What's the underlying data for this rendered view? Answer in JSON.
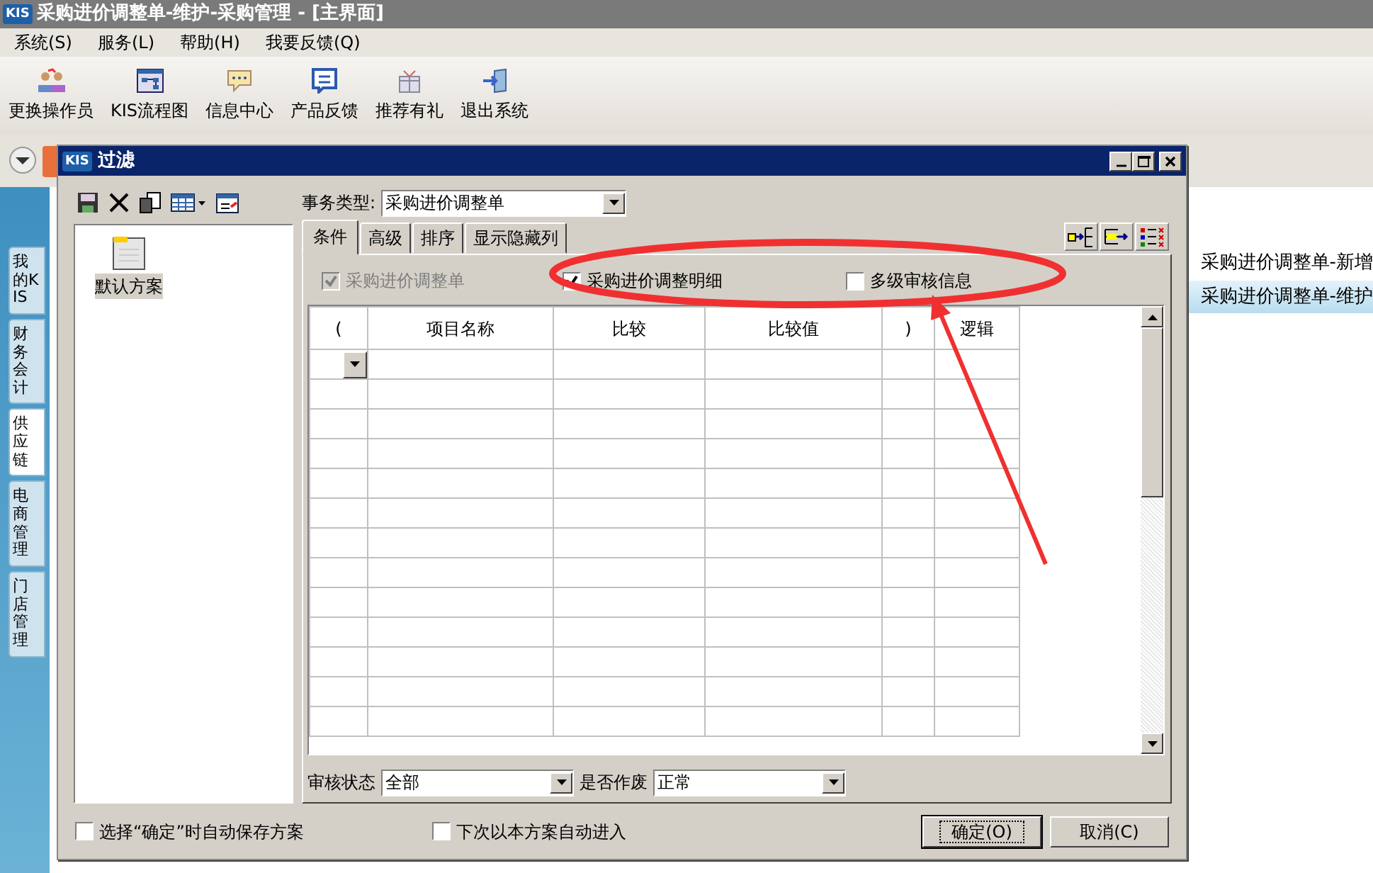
{
  "window": {
    "logo": "KIS",
    "title": "采购进价调整单-维护-采购管理 - [主界面]"
  },
  "menu": [
    {
      "label": "系统(S)"
    },
    {
      "label": "服务(L)"
    },
    {
      "label": "帮助(H)"
    },
    {
      "label": "我要反馈(Q)"
    }
  ],
  "toolbar": [
    {
      "label": "更换操作员",
      "kind": "people"
    },
    {
      "label": "KIS流程图",
      "kind": "flow"
    },
    {
      "label": "信息中心",
      "kind": "chat"
    },
    {
      "label": "产品反馈",
      "kind": "form"
    },
    {
      "label": "推荐有礼",
      "kind": "gift"
    },
    {
      "label": "退出系统",
      "kind": "exit"
    }
  ],
  "side_tabs": [
    {
      "label": "我的KIS",
      "selected": false
    },
    {
      "label": "财务会计",
      "selected": false
    },
    {
      "label": "供应链",
      "selected": true
    },
    {
      "label": "电商管理",
      "selected": false
    },
    {
      "label": "门店管理",
      "selected": false
    }
  ],
  "right_list": [
    {
      "label": "采购进价调整单-新增",
      "selected": false
    },
    {
      "label": "采购进价调整单-维护",
      "selected": true
    }
  ],
  "dialog": {
    "logo": "KIS",
    "title": "过滤",
    "business_type": {
      "label": "事务类型:",
      "value": "采购进价调整单"
    },
    "schemes": [
      {
        "label": "默认方案",
        "selected": true
      }
    ],
    "tabs": [
      {
        "label": "条件",
        "selected": true
      },
      {
        "label": "高级",
        "selected": false
      },
      {
        "label": "排序",
        "selected": false
      },
      {
        "label": "显示隐藏列",
        "selected": false
      }
    ],
    "options": [
      {
        "label": "采购进价调整单",
        "checked": true,
        "disabled": true
      },
      {
        "label": "采购进价调整明细",
        "checked": true,
        "disabled": false
      },
      {
        "label": "多级审核信息",
        "checked": false,
        "disabled": false
      }
    ],
    "grid": {
      "columns": [
        "(",
        "项目名称",
        "比较",
        "比较值",
        ")",
        "逻辑"
      ]
    },
    "audit_status": {
      "label": "审核状态",
      "value": "全部"
    },
    "voided": {
      "label": "是否作废",
      "value": "正常"
    },
    "footer_options": [
      {
        "label": "选择“确定”时自动保存方案",
        "checked": false
      },
      {
        "label": "下次以本方案自动进入",
        "checked": false
      }
    ],
    "buttons": [
      {
        "label": "确定(O)",
        "default": true
      },
      {
        "label": "取消(C)",
        "default": false
      }
    ]
  },
  "annotation": {
    "ellipse": true,
    "arrow": true
  }
}
